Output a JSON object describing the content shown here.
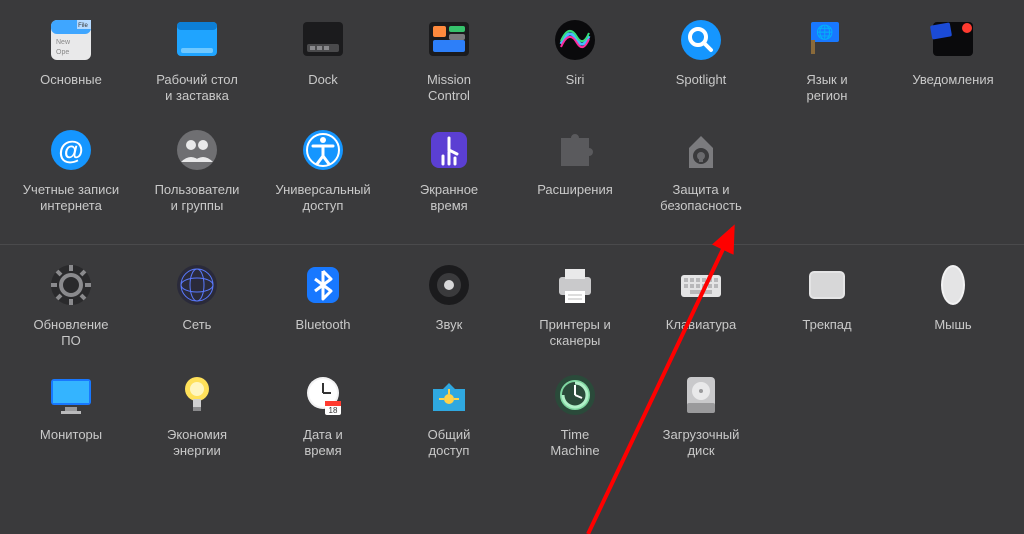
{
  "sections": [
    {
      "items": [
        {
          "id": "general",
          "icon": "general-icon",
          "label": "Основные"
        },
        {
          "id": "desktop",
          "icon": "desktop-icon",
          "label": "Рабочий стол\nи заставка"
        },
        {
          "id": "dock",
          "icon": "dock-icon",
          "label": "Dock"
        },
        {
          "id": "mission-control",
          "icon": "mission-control-icon",
          "label": "Mission\nControl"
        },
        {
          "id": "siri",
          "icon": "siri-icon",
          "label": "Siri"
        },
        {
          "id": "spotlight",
          "icon": "spotlight-icon",
          "label": "Spotlight"
        },
        {
          "id": "language-region",
          "icon": "language-icon",
          "label": "Язык и\nрегион"
        },
        {
          "id": "notifications",
          "icon": "notifications-icon",
          "label": "Уведомления"
        },
        {
          "id": "internet-accounts",
          "icon": "at-icon",
          "label": "Учетные записи\nинтернета"
        },
        {
          "id": "users-groups",
          "icon": "users-icon",
          "label": "Пользователи\nи группы"
        },
        {
          "id": "accessibility",
          "icon": "accessibility-icon",
          "label": "Универсальный\nдоступ"
        },
        {
          "id": "screen-time",
          "icon": "screentime-icon",
          "label": "Экранное\nвремя"
        },
        {
          "id": "extensions",
          "icon": "puzzle-icon",
          "label": "Расширения"
        },
        {
          "id": "security",
          "icon": "security-icon",
          "label": "Защита и\nбезопасность"
        }
      ]
    },
    {
      "items": [
        {
          "id": "software-update",
          "icon": "gear-icon",
          "label": "Обновление\nПО"
        },
        {
          "id": "network",
          "icon": "network-icon",
          "label": "Сеть"
        },
        {
          "id": "bluetooth",
          "icon": "bluetooth-icon",
          "label": "Bluetooth"
        },
        {
          "id": "sound",
          "icon": "sound-icon",
          "label": "Звук"
        },
        {
          "id": "printers",
          "icon": "printer-icon",
          "label": "Принтеры и\nсканеры"
        },
        {
          "id": "keyboard",
          "icon": "keyboard-icon",
          "label": "Клавиатура"
        },
        {
          "id": "trackpad",
          "icon": "trackpad-icon",
          "label": "Трекпад"
        },
        {
          "id": "mouse",
          "icon": "mouse-icon",
          "label": "Мышь"
        },
        {
          "id": "displays",
          "icon": "display-icon",
          "label": "Мониторы"
        },
        {
          "id": "energy",
          "icon": "bulb-icon",
          "label": "Экономия\nэнергии"
        },
        {
          "id": "date-time",
          "icon": "clock-icon",
          "label": "Дата и\nвремя"
        },
        {
          "id": "sharing",
          "icon": "sharing-icon",
          "label": "Общий\nдоступ"
        },
        {
          "id": "time-machine",
          "icon": "timemachine-icon",
          "label": "Time\nMachine"
        },
        {
          "id": "startup-disk",
          "icon": "disk-icon",
          "label": "Загрузочный\nдиск"
        }
      ]
    }
  ],
  "annotation": {
    "type": "arrow",
    "target": "security",
    "color": "#ff0000"
  }
}
